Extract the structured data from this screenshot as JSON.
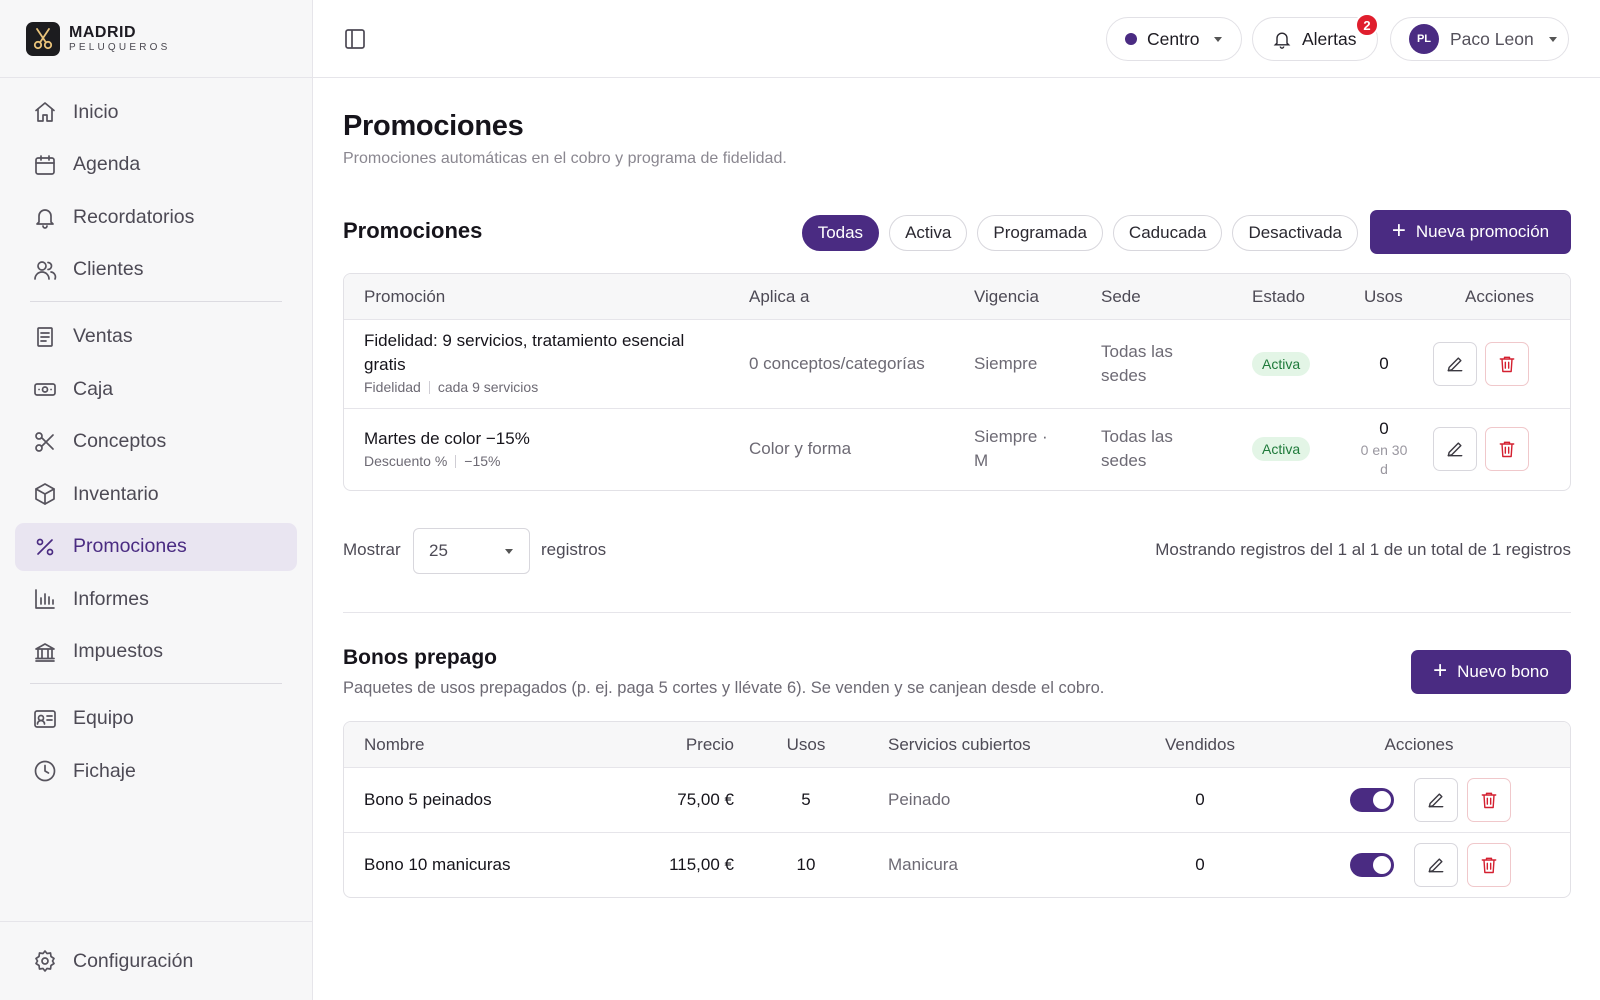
{
  "brand": {
    "name": "MADRID",
    "sub": "PELUQUEROS"
  },
  "sidebar": {
    "items": [
      {
        "label": "Inicio",
        "icon": "home-icon"
      },
      {
        "label": "Agenda",
        "icon": "calendar-icon"
      },
      {
        "label": "Recordatorios",
        "icon": "bell-icon"
      },
      {
        "label": "Clientes",
        "icon": "users-icon"
      },
      {
        "label": "Ventas",
        "icon": "receipt-icon"
      },
      {
        "label": "Caja",
        "icon": "cash-icon"
      },
      {
        "label": "Conceptos",
        "icon": "scissors-icon"
      },
      {
        "label": "Inventario",
        "icon": "box-icon"
      },
      {
        "label": "Promociones",
        "icon": "percent-icon",
        "active": true
      },
      {
        "label": "Informes",
        "icon": "bar-chart-icon"
      },
      {
        "label": "Impuestos",
        "icon": "bank-icon"
      },
      {
        "label": "Equipo",
        "icon": "id-card-icon"
      },
      {
        "label": "Fichaje",
        "icon": "clock-icon"
      }
    ],
    "config": {
      "label": "Configuración",
      "icon": "gear-icon"
    }
  },
  "topbar": {
    "location": "Centro",
    "alerts_label": "Alertas",
    "alerts_count": "2",
    "user_initials": "PL",
    "user_name": "Paco Leon"
  },
  "page": {
    "title": "Promociones",
    "subtitle": "Promociones automáticas en el cobro y programa de fidelidad."
  },
  "promos": {
    "title": "Promociones",
    "filters": [
      "Todas",
      "Activa",
      "Programada",
      "Caducada",
      "Desactivada"
    ],
    "active_filter": "Todas",
    "new_button": "Nueva promoción",
    "columns": [
      "Promoción",
      "Aplica a",
      "Vigencia",
      "Sede",
      "Estado",
      "Usos",
      "Acciones"
    ],
    "rows": [
      {
        "name": "Fidelidad: 9 servicios, tratamiento esencial gratis",
        "type": "Fidelidad",
        "detail": "cada 9 servicios",
        "applies": "0 conceptos/categorías",
        "validity": "Siempre",
        "sede": "Todas las sedes",
        "status": "Activa",
        "uses": "0",
        "uses_sub": ""
      },
      {
        "name": "Martes de color −15%",
        "type": "Descuento %",
        "detail": "−15%",
        "applies": "Color y forma",
        "validity": "Siempre · M",
        "sede": "Todas las sedes",
        "status": "Activa",
        "uses": "0",
        "uses_sub": "0 en 30 d"
      }
    ],
    "pager": {
      "show_label": "Mostrar",
      "page_size": "25",
      "records_label": "registros",
      "info": "Mostrando registros del 1 al 1 de un total de 1 registros"
    }
  },
  "bonos": {
    "title": "Bonos prepago",
    "subtitle": "Paquetes de usos prepagados (p. ej. paga 5 cortes y llévate 6). Se venden y se canjean desde el cobro.",
    "new_button": "Nuevo bono",
    "columns": [
      "Nombre",
      "Precio",
      "Usos",
      "Servicios cubiertos",
      "Vendidos",
      "Acciones"
    ],
    "rows": [
      {
        "name": "Bono 5 peinados",
        "price": "75,00 €",
        "uses": "5",
        "services": "Peinado",
        "sold": "0",
        "enabled": true
      },
      {
        "name": "Bono 10 manicuras",
        "price": "115,00 €",
        "uses": "10",
        "services": "Manicura",
        "sold": "0",
        "enabled": true
      }
    ]
  },
  "colors": {
    "accent": "#4a2b82",
    "danger": "#d42030",
    "success_bg": "#e3f5e6",
    "success_text": "#1e7a3a"
  }
}
